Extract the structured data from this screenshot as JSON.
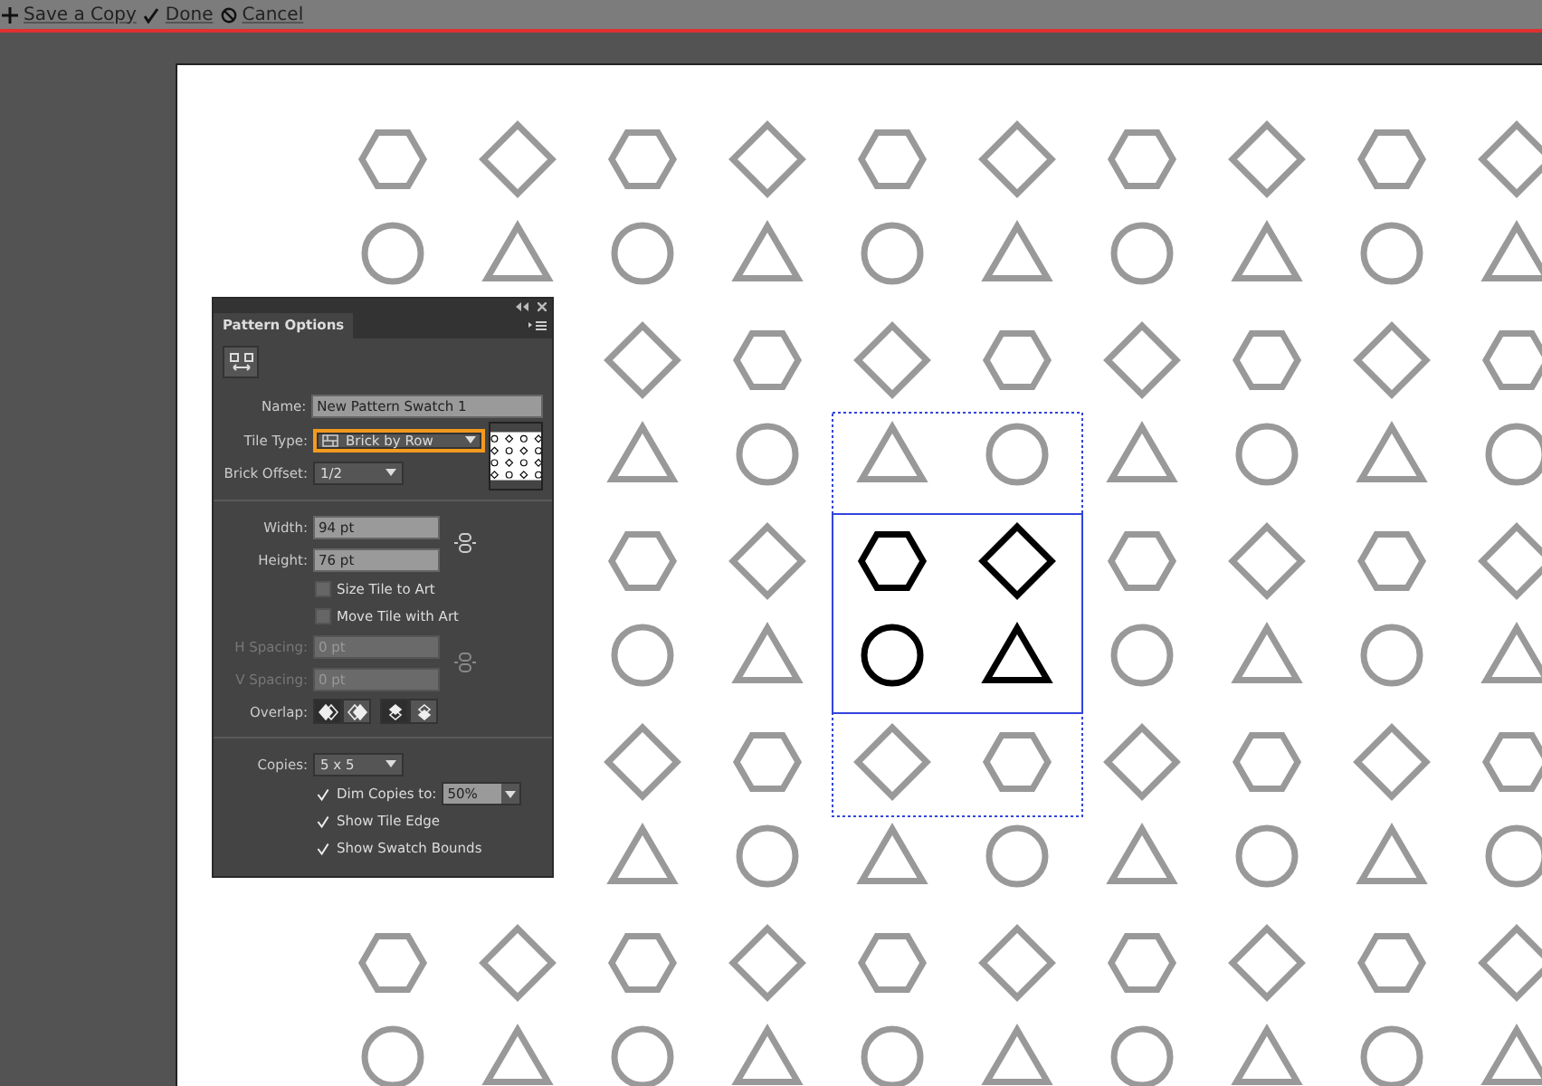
{
  "toolbar": {
    "actions": [
      {
        "kind": "plus",
        "label": "Save a Copy"
      },
      {
        "kind": "check",
        "label": "Done"
      },
      {
        "kind": "cancel",
        "label": "Cancel"
      }
    ]
  },
  "panel": {
    "title": "Pattern Options",
    "name": {
      "label": "Name:",
      "value": "New Pattern Swatch 1"
    },
    "tile_type": {
      "label": "Tile Type:",
      "value": "Brick by Row",
      "highlighted": true
    },
    "brick_offset": {
      "label": "Brick Offset:",
      "value": "1/2"
    },
    "width": {
      "label": "Width:",
      "value": "94 pt"
    },
    "height": {
      "label": "Height:",
      "value": "76 pt"
    },
    "tile_options": [
      {
        "label": "Size Tile to Art",
        "checked": false
      },
      {
        "label": "Move Tile with Art",
        "checked": false
      }
    ],
    "h_spacing": {
      "label": "H Spacing:",
      "value": "0 pt",
      "disabled": true
    },
    "v_spacing": {
      "label": "V Spacing:",
      "value": "0 pt",
      "disabled": true
    },
    "overlap": {
      "label": "Overlap:",
      "buttons": [
        {
          "selected": true
        },
        {
          "selected": false
        },
        {
          "selected": true
        },
        {
          "selected": false
        }
      ]
    },
    "copies": {
      "label": "Copies:",
      "value": "5 x 5"
    },
    "dim_copies": {
      "label": "Dim Copies to:",
      "checked": true,
      "value": "50%"
    },
    "show_options": [
      {
        "label": "Show Tile Edge",
        "checked": true
      },
      {
        "label": "Show Swatch Bounds",
        "checked": true
      }
    ]
  }
}
